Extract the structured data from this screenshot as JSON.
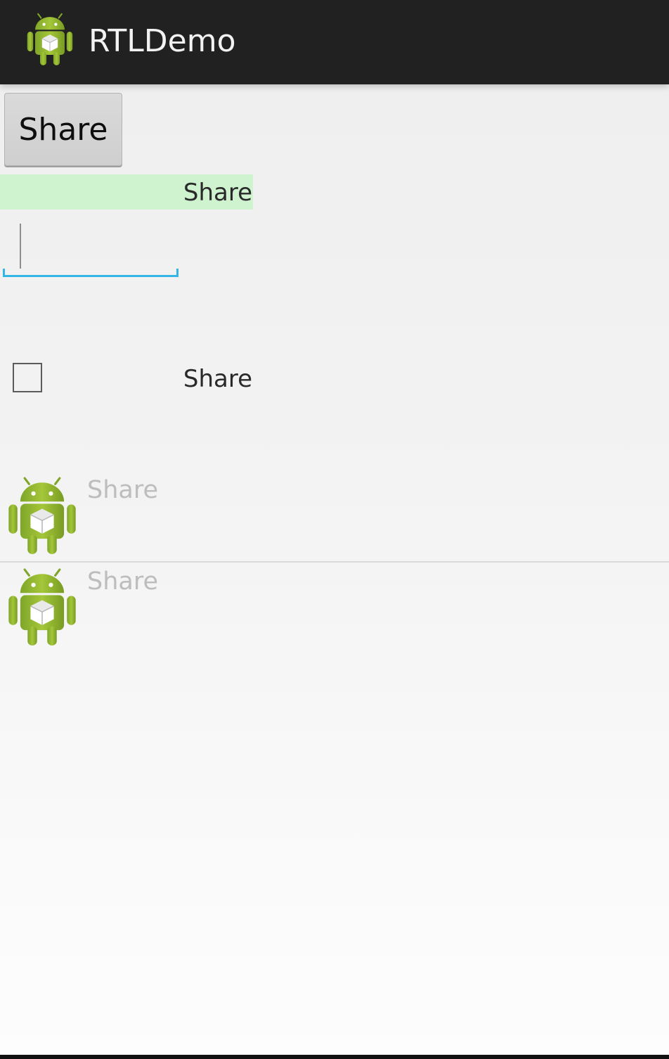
{
  "action_bar": {
    "title": "RTLDemo",
    "icon": "android-robot-icon"
  },
  "main": {
    "button_label": "Share",
    "green_label": "Share",
    "edit_text": {
      "value": "",
      "placeholder": ""
    },
    "checkbox": {
      "label": "Share",
      "checked": false
    },
    "list_items": [
      {
        "label": "Share",
        "icon": "android-robot-icon"
      },
      {
        "label": "Share",
        "icon": "android-robot-icon"
      }
    ]
  },
  "colors": {
    "action_bar": "#212121",
    "edit_accent": "#33b5e5",
    "green_label_bg": "#cff2cf",
    "android_green": "#97c024"
  }
}
